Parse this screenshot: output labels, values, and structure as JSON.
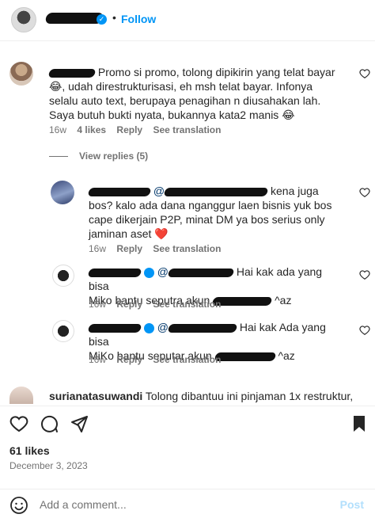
{
  "header": {
    "follow_label": "Follow",
    "separator": "•"
  },
  "comments": [
    {
      "text": "Promo si promo, tolong dipikirin yang telat bayar 😂, udah direstrukturisasi, eh msh telat bayar. Infonya selalu auto text, berupaya penagihan n diusahakan lah. Saya butuh bukti nyata, bukannya kata2 manis 😂",
      "time": "16w",
      "likes": "4 likes",
      "reply": "Reply",
      "translate": "See translation"
    }
  ],
  "view_replies": "View replies (5)",
  "replies": [
    {
      "text": "kena juga bos? kalo ada dana nganggur laen bisnis yuk bos cape dikerjain P2P, minat DM ya bos serius only jaminan aset",
      "heart_emoji": "❤️",
      "time": "16w",
      "reply": "Reply",
      "translate": "See translation"
    },
    {
      "line1": "Hai kak ada yang bisa",
      "line2_a": "Miko bantu seputra akun",
      "line2_b": "^az",
      "time": "16w",
      "reply": "Reply",
      "translate": "See translation"
    },
    {
      "line1": "Hai kak Ada yang bisa",
      "line2_a": "MiKo bantu seputar akun",
      "line2_b": "^az",
      "time": "16w",
      "reply": "Reply",
      "translate": "See translation"
    }
  ],
  "last_comment": {
    "username": "surianatasuwandi",
    "text": "Tolong dibantuu ini pinjaman 1x restruktur,"
  },
  "post": {
    "likes": "61 likes",
    "date": "December 3, 2023"
  },
  "add_comment": {
    "placeholder": "Add a comment...",
    "post_label": "Post"
  },
  "icons": {
    "like": "heart-icon",
    "comment": "comment-icon",
    "share": "send-icon",
    "save": "bookmark-icon",
    "emoji": "smiley-icon",
    "verified": "verified-badge-icon"
  },
  "colors": {
    "link_blue": "#0095f6",
    "muted": "#737373",
    "text": "#262626",
    "heart_red": "#ed4956"
  }
}
